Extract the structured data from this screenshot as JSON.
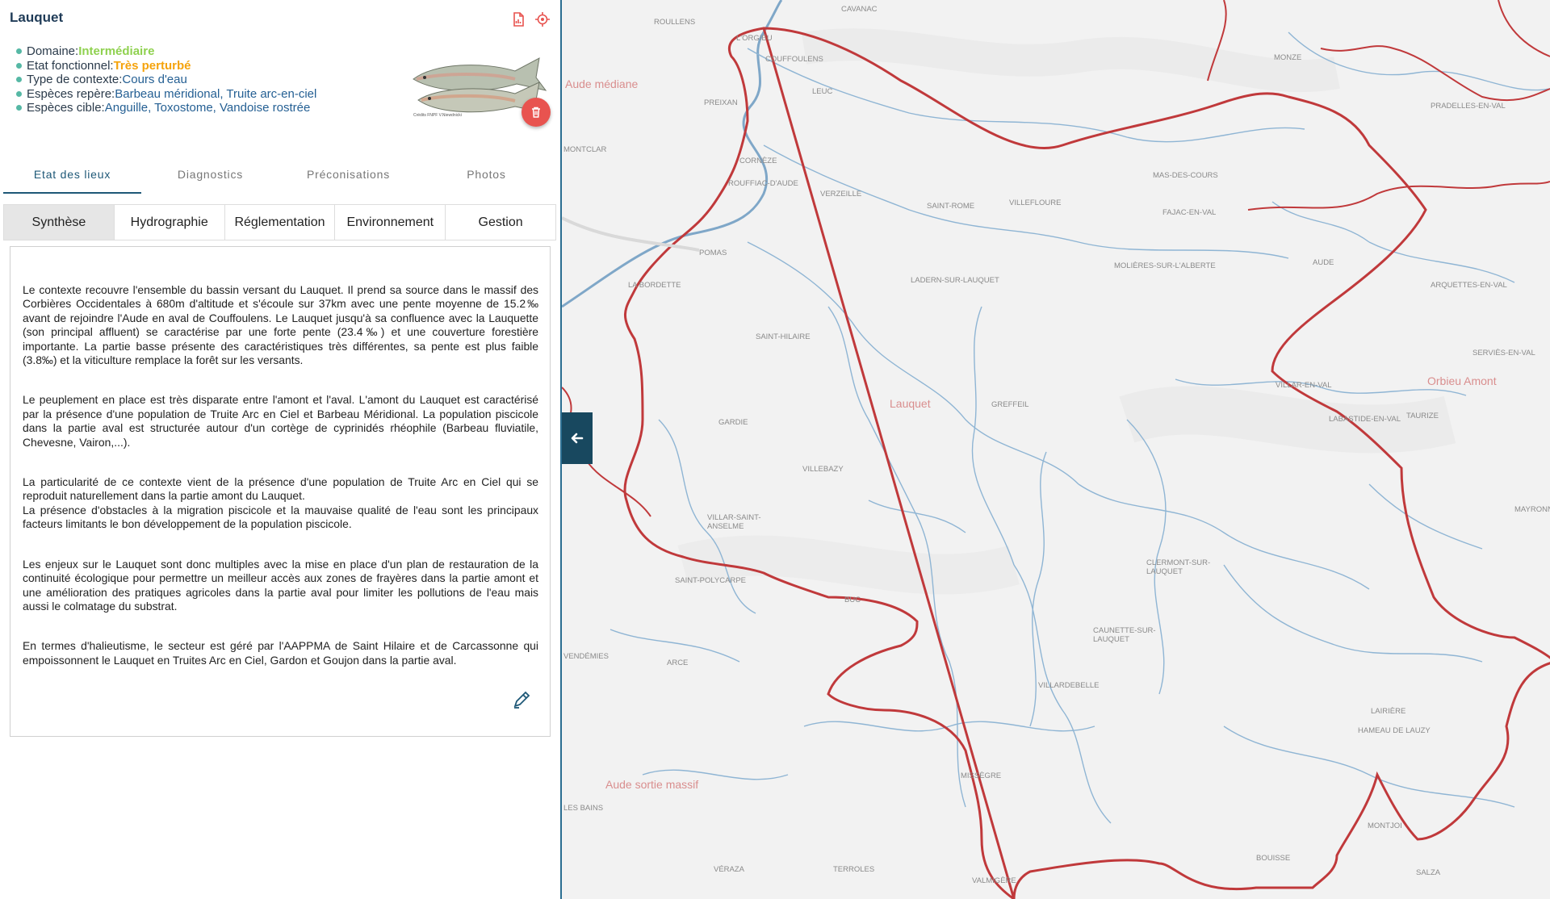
{
  "panel": {
    "title": "Lauquet",
    "info": {
      "domaine_label": "Domaine: ",
      "domaine_value": "Intermédiaire",
      "etat_label": "Etat fonctionnel: ",
      "etat_value": "Très perturbé",
      "type_label": "Type de contexte: ",
      "type_value": "Cours d'eau",
      "reperes_label": "Espèces repère: ",
      "reperes_value": "Barbeau méridional, Truite arc-en-ciel",
      "cibles_label": "Espèces cible: ",
      "cibles_value": "Anguille, Toxostome, Vandoise rostrée"
    },
    "image_credit": "Crédits FNPF V.Niewdnicki",
    "tabs": [
      "Etat des lieux",
      "Diagnostics",
      "Préconisations",
      "Photos"
    ],
    "subtabs": [
      "Synthèse",
      "Hydrographie",
      "Réglementation",
      "Environnement",
      "Gestion"
    ],
    "paragraphs": [
      "Le contexte recouvre l'ensemble du bassin versant du Lauquet. Il prend sa source dans le massif des Corbières Occidentales à 680m d'altitude et s'écoule sur 37km avec une pente moyenne de 15.2‰ avant de rejoindre l'Aude en aval de Couffoulens. Le Lauquet jusqu'à sa confluence avec la Lauquette (son principal affluent) se caractérise par une forte pente (23.4‰) et une couverture forestière importante. La partie basse présente des caractéristiques très différentes, sa pente est plus faible (3.8‰) et la viticulture remplace la forêt sur les versants.",
      "Le peuplement en place est très disparate entre l'amont et l'aval. L'amont du Lauquet est caractérisé par la présence d'une population de Truite Arc en Ciel et Barbeau Méridional. La population piscicole dans la partie aval est structurée autour d'un cortège de cyprinidés rhéophile (Barbeau fluviatile, Chevesne, Vairon,...).",
      "La particularité de ce contexte vient de la présence d'une population de Truite Arc en Ciel qui se reproduit naturellement dans la partie amont du Lauquet.\nLa présence d'obstacles à la migration piscicole et la mauvaise qualité de l'eau sont les principaux facteurs limitants le bon développement de la population piscicole.",
      "Les enjeux sur le Lauquet sont donc multiples avec la mise en place d'un plan de restauration de la continuité écologique pour permettre un meilleur accès aux zones de frayères dans la partie amont et une amélioration des pratiques agricoles dans la partie aval pour limiter les pollutions de l'eau mais aussi le colmatage du substrat.",
      "En termes d'halieutisme, le secteur est géré par l'AAPPMA de Saint Hilaire et de Carcassonne qui empoissonnent le Lauquet en Truites Arc en Ciel, Gardon et Goujon dans la partie aval."
    ]
  },
  "map": {
    "regions": [
      "Aude médiane",
      "Lauquet",
      "Orbieu Amont",
      "Aude sortie massif"
    ],
    "places": [
      "ROULLENS",
      "CAVANAC",
      "L'ORGIEU",
      "COUFFOULENS",
      "LEUC",
      "PREIXAN",
      "MONTCLAR",
      "CORNÈZE",
      "ROUFFIAC-D'AUDE",
      "VERZEILLE",
      "POMAS",
      "LA BORDETTE",
      "SAINT-ROME",
      "VILLEFLOURE",
      "MAS-DES-COURS",
      "FAJAC-EN-VAL",
      "MONZE",
      "PRADELLES-EN-VAL",
      "LADERN-SUR-LAUQUET",
      "MOLIÈRES-SUR-L'ALBERTE",
      "AUDE",
      "ARQUETTES-EN-VAL",
      "SAINT-HILAIRE",
      "SERVIÈS-EN-VAL",
      "VILLAR-EN-VAL",
      "GREFFEIL",
      "GARDIE",
      "LABASTIDE-EN-VAL",
      "TAURIZE",
      "VILLEBAZY",
      "VILLAR-SAINT-ANSELME",
      "CLERMONT-SUR-LAUQUET",
      "SAINT-POLYCARPE",
      "BUC",
      "CAUNETTE-SUR-LAUQUET",
      "VENDÉMIES",
      "ARCE",
      "VILLARDEBELLE",
      "LAIRIÈRE",
      "HAMEAU DE LAUZY",
      "MISSÈGRE",
      "LES BAINS",
      "MONTJOI",
      "BOUISSE",
      "VÉRAZA",
      "TERROLES",
      "VALMIGÈRE",
      "SALZA",
      "MAYRONNES"
    ]
  },
  "colors": {
    "accent": "#1e5877",
    "boundary": "#c0393b",
    "river": "#6f9ec0",
    "fab": "#e8534f"
  },
  "icons": [
    "pdf-icon",
    "locate-icon",
    "trash-icon",
    "edit-icon",
    "arrow-left-icon"
  ]
}
